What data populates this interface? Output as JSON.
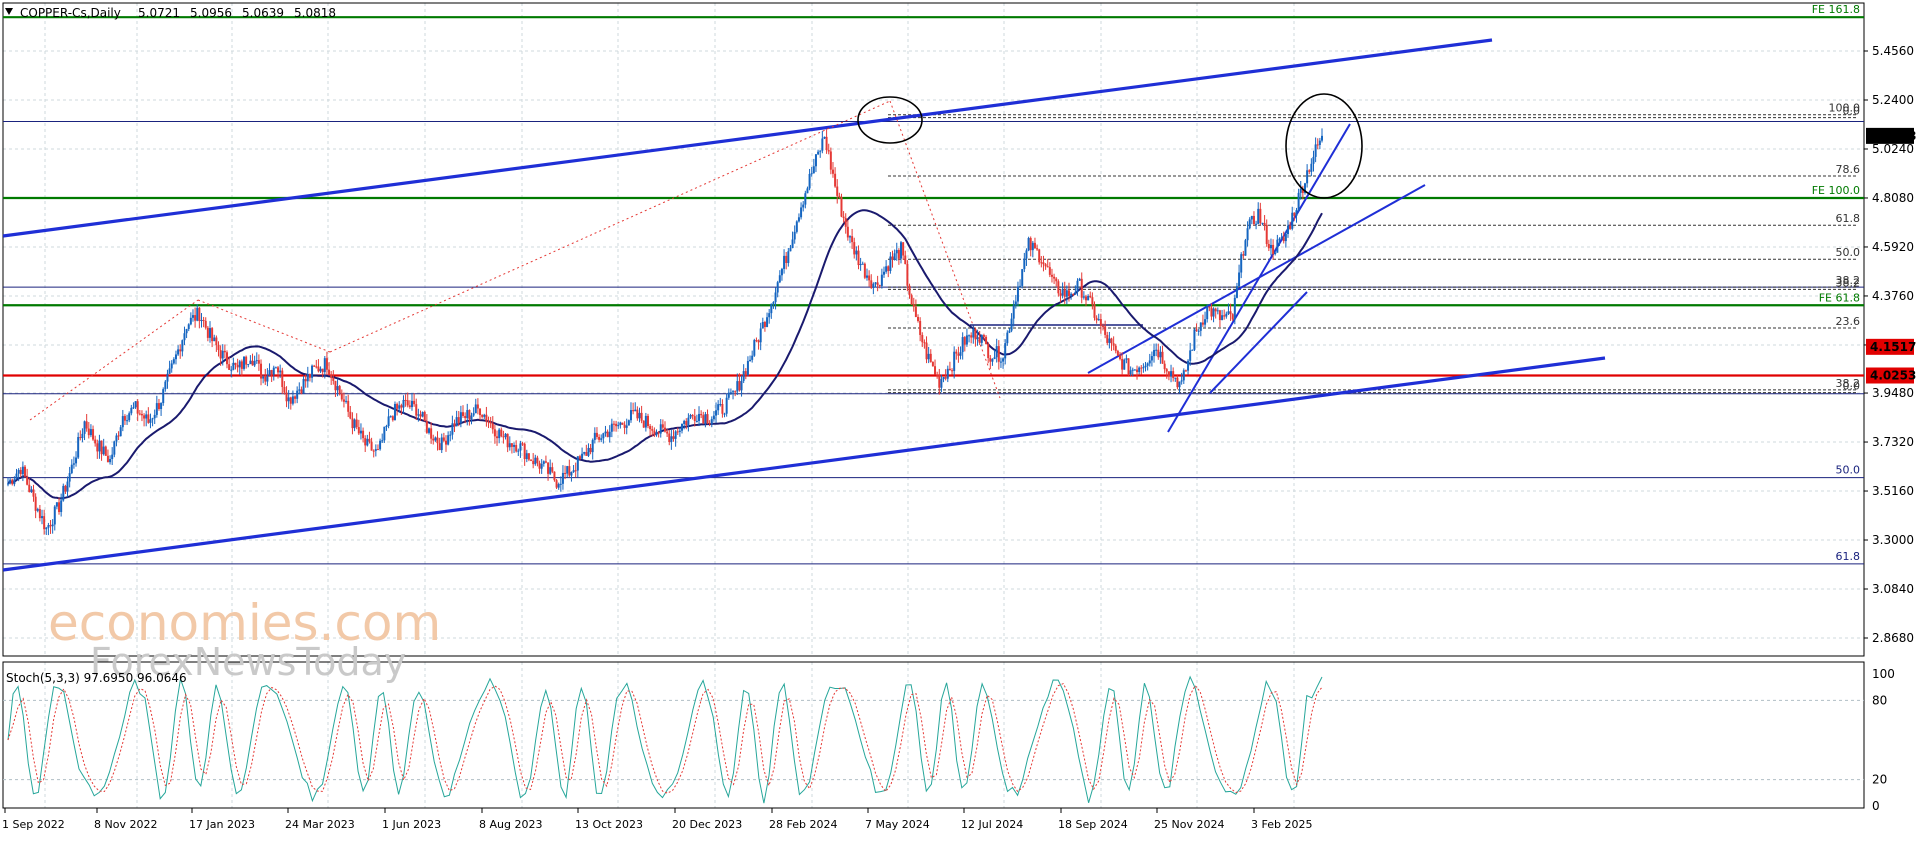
{
  "chart_data": {
    "type": "candlestick",
    "symbol_line": {
      "symbol": "COPPER-Cs,Daily",
      "open": "5.0721",
      "high": "5.0956",
      "low": "5.0639",
      "close": "5.0818"
    },
    "x_labels": [
      "1 Sep 2022",
      "8 Nov 2022",
      "17 Jan 2023",
      "24 Mar 2023",
      "1 Jun 2023",
      "8 Aug 2023",
      "13 Oct 2023",
      "20 Dec 2023",
      "28 Feb 2024",
      "7 May 2024",
      "12 Jul 2024",
      "18 Sep 2024",
      "25 Nov 2024",
      "3 Feb 2025"
    ],
    "y_ticks": [
      "5.4560",
      "5.2400",
      "5.0240",
      "4.8080",
      "4.5920",
      "4.3760",
      "4.1600",
      "3.9480",
      "3.7320",
      "3.5160",
      "3.3000",
      "3.0840",
      "2.8680"
    ],
    "y_tick_values": [
      5.456,
      5.24,
      5.024,
      4.808,
      4.592,
      4.376,
      4.16,
      3.948,
      3.732,
      3.516,
      3.3,
      3.084,
      2.868
    ],
    "ylim": [
      2.78,
      5.62
    ],
    "current_price": "5.0818",
    "price_tags": [
      {
        "text": "5.0818",
        "value": 5.0818,
        "color": "#000000"
      },
      {
        "text": "4.1517",
        "value": 4.1517,
        "color": "#e00000"
      },
      {
        "text": "4.0253",
        "value": 4.0253,
        "color": "#e00000"
      }
    ],
    "horizontal_levels": [
      {
        "value": 5.605,
        "label": "FE 161.8",
        "color": "#007a00"
      },
      {
        "value": 4.808,
        "label": "FE 100.0",
        "color": "#007a00"
      },
      {
        "value": 4.335,
        "label": "FE 61.8",
        "color": "#007a00"
      },
      {
        "value": 4.0253,
        "label": "",
        "color": "#e00000"
      },
      {
        "value": 5.145,
        "label": "",
        "color": "#1a237e"
      },
      {
        "value": 4.415,
        "label": "",
        "color": "#1a237e"
      },
      {
        "value": 3.945,
        "label": "",
        "color": "#1a237e"
      },
      {
        "value": 3.575,
        "label": "50.0",
        "color": "#1a237e"
      },
      {
        "value": 3.195,
        "label": "61.8",
        "color": "#1a237e"
      }
    ],
    "fib_retracement": [
      {
        "value": 5.175,
        "label": "100.0"
      },
      {
        "value": 5.162,
        "label": "0.0"
      },
      {
        "value": 4.905,
        "label": "78.6"
      },
      {
        "value": 4.688,
        "label": "61.8"
      },
      {
        "value": 4.538,
        "label": "50.0"
      },
      {
        "value": 4.415,
        "label": "38.2"
      },
      {
        "value": 4.405,
        "label": "38.2"
      },
      {
        "value": 4.235,
        "label": "23.6"
      },
      {
        "value": 3.962,
        "label": "38.2"
      },
      {
        "value": 3.95,
        "label": "0.0"
      }
    ],
    "close_series": [
      3.55,
      3.62,
      3.48,
      3.35,
      3.45,
      3.62,
      3.82,
      3.72,
      3.65,
      3.85,
      3.88,
      3.82,
      3.92,
      4.08,
      4.25,
      4.3,
      4.18,
      4.1,
      4.05,
      4.12,
      4.02,
      4.08,
      3.92,
      3.98,
      4.05,
      4.08,
      3.95,
      3.82,
      3.72,
      3.68,
      3.85,
      3.9,
      3.88,
      3.78,
      3.72,
      3.82,
      3.85,
      3.88,
      3.8,
      3.74,
      3.72,
      3.66,
      3.62,
      3.56,
      3.6,
      3.66,
      3.74,
      3.78,
      3.81,
      3.85,
      3.82,
      3.78,
      3.76,
      3.82,
      3.86,
      3.84,
      3.88,
      3.95,
      4.08,
      4.22,
      4.38,
      4.55,
      4.75,
      4.92,
      5.08,
      4.82,
      4.62,
      4.5,
      4.42,
      4.52,
      4.58,
      4.3,
      4.12,
      4.0,
      4.08,
      4.18,
      4.22,
      4.12,
      4.12,
      4.38,
      4.6,
      4.55,
      4.42,
      4.38,
      4.42,
      4.32,
      4.2,
      4.1,
      4.05,
      4.08,
      4.15,
      4.05,
      3.98,
      4.2,
      4.32,
      4.28,
      4.28,
      4.65,
      4.74,
      4.58,
      4.62,
      4.78,
      4.95,
      5.0818
    ],
    "stochastic": {
      "label": "Stoch(5,3,3) 97.6950 96.0646",
      "ticks": [
        "100",
        "80",
        "20",
        "0"
      ],
      "tick_values": [
        100,
        80,
        20,
        0
      ]
    },
    "watermark": {
      "line1": "economies.com",
      "line2": "ForexNewsToday"
    }
  }
}
